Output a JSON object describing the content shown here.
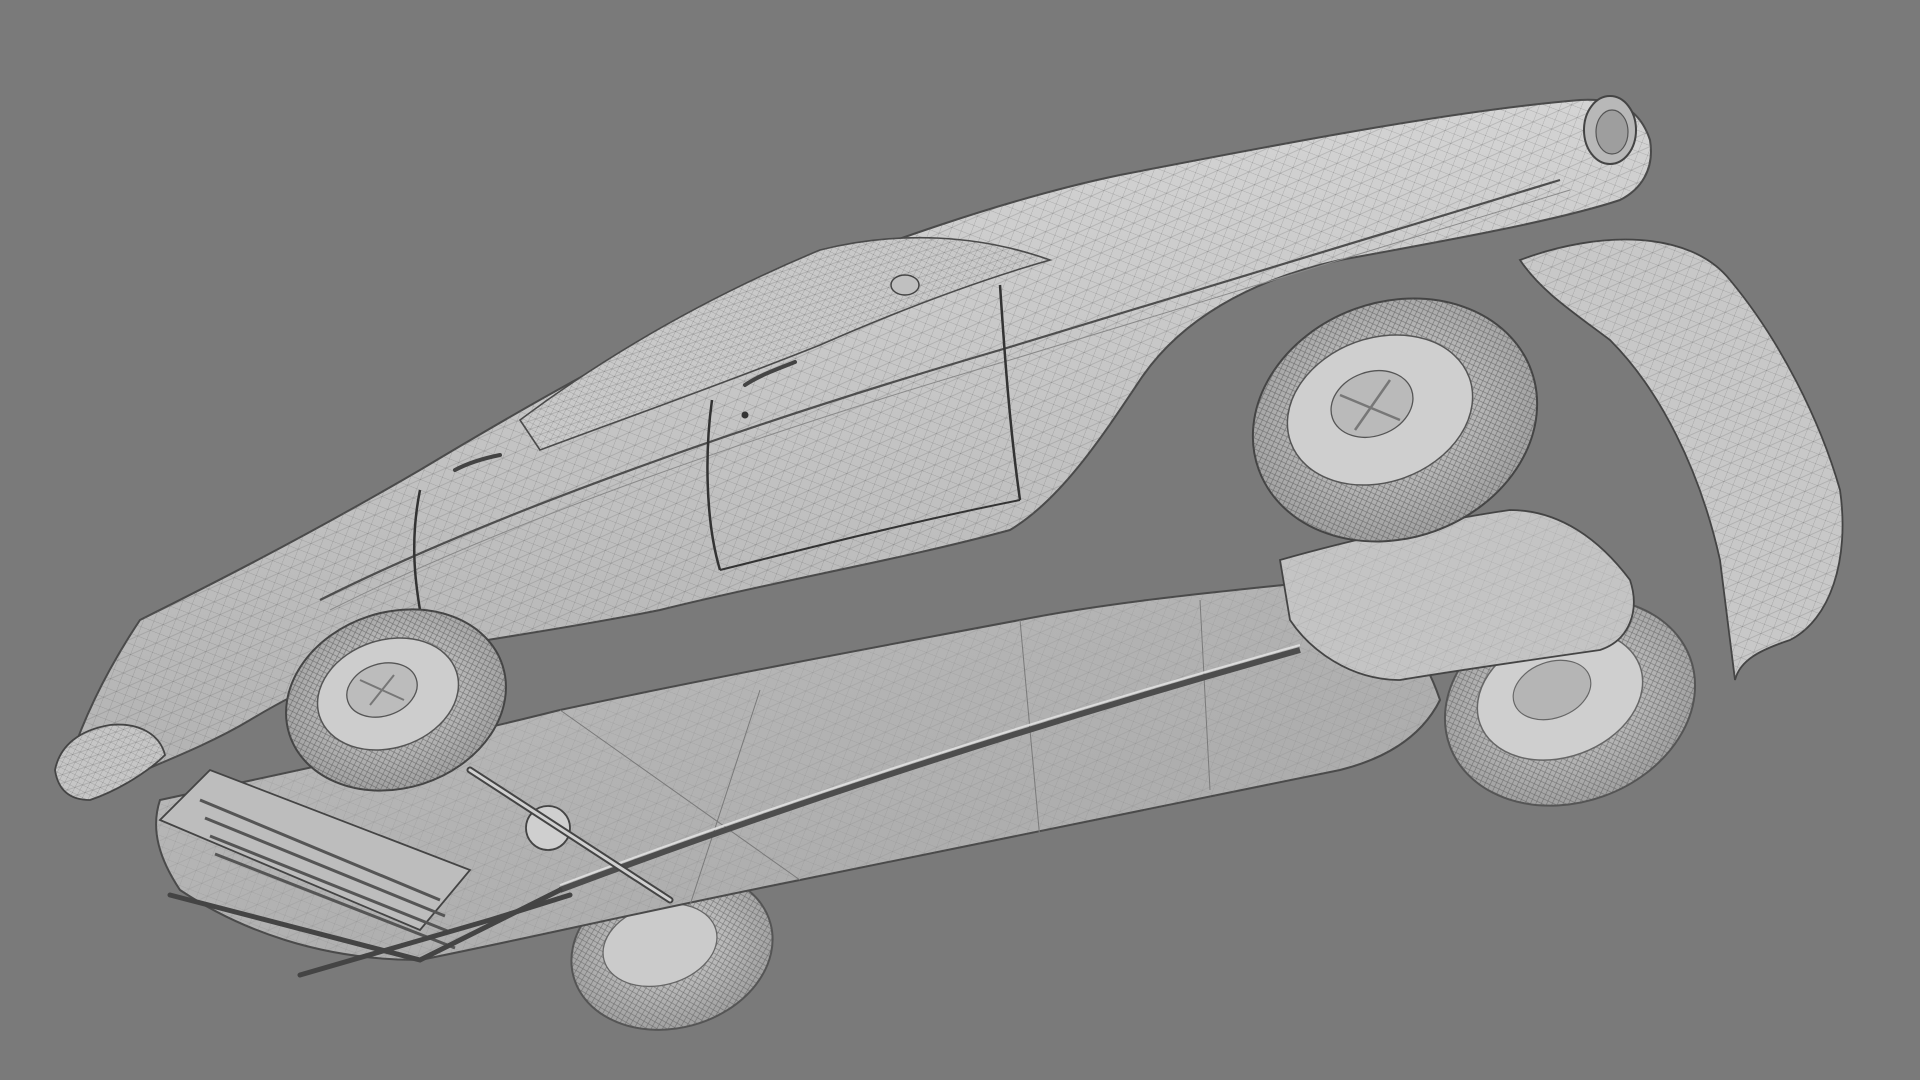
{
  "viewport": {
    "background_color": "#7a7a7a",
    "render_mode": "shaded-wireframe",
    "object": "car-underside-view",
    "mesh_base_color": "#c4c4c4",
    "mesh_edge_color": "#5a5a5a"
  }
}
